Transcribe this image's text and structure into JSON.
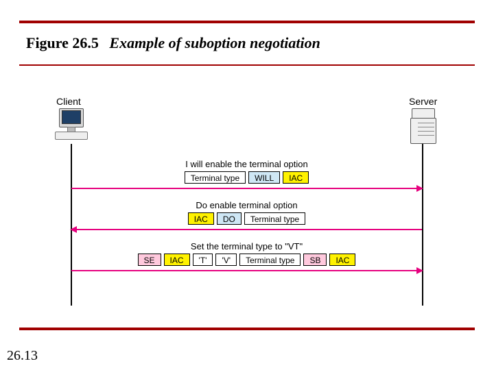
{
  "figure": {
    "label": "Figure 26.5",
    "caption": "Example of suboption negotiation"
  },
  "page_number": "26.13",
  "actors": {
    "client": "Client",
    "server": "Server"
  },
  "messages": {
    "m1": {
      "caption": "I will enable the terminal option",
      "packets": [
        "Terminal type",
        "WILL",
        "IAC"
      ]
    },
    "m2": {
      "caption": "Do enable terminal option",
      "packets": [
        "IAC",
        "DO",
        "Terminal type"
      ]
    },
    "m3": {
      "caption": "Set the terminal type to \"VT\"",
      "packets": [
        "SE",
        "IAC",
        "'T'",
        "'V'",
        "Terminal type",
        "SB",
        "IAC"
      ]
    }
  },
  "colors": {
    "rule": "#a00000",
    "arrow": "#e6007e",
    "yellow": "#fff200",
    "blue": "#cfe7f5",
    "pink": "#ffc9dd"
  }
}
